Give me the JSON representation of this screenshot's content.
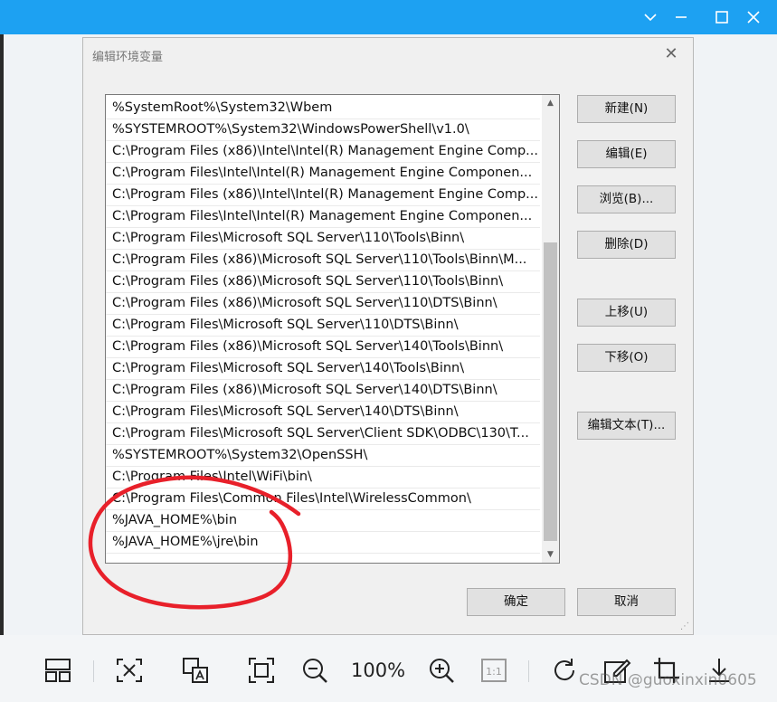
{
  "viewer": {
    "zoom_label": "100%",
    "watermark": "CSDN @guoxinxin0605"
  },
  "dialog": {
    "title": "编辑环境变量",
    "close_glyph": "✕",
    "entries": [
      "%SystemRoot%\\System32\\Wbem",
      "%SYSTEMROOT%\\System32\\WindowsPowerShell\\v1.0\\",
      "C:\\Program Files (x86)\\Intel\\Intel(R) Management Engine Comp...",
      "C:\\Program Files\\Intel\\Intel(R) Management Engine Componen...",
      "C:\\Program Files (x86)\\Intel\\Intel(R) Management Engine Comp...",
      "C:\\Program Files\\Intel\\Intel(R) Management Engine Componen...",
      "C:\\Program Files\\Microsoft SQL Server\\110\\Tools\\Binn\\",
      "C:\\Program Files (x86)\\Microsoft SQL Server\\110\\Tools\\Binn\\M...",
      "C:\\Program Files (x86)\\Microsoft SQL Server\\110\\Tools\\Binn\\",
      "C:\\Program Files (x86)\\Microsoft SQL Server\\110\\DTS\\Binn\\",
      "C:\\Program Files\\Microsoft SQL Server\\110\\DTS\\Binn\\",
      "C:\\Program Files (x86)\\Microsoft SQL Server\\140\\Tools\\Binn\\",
      "C:\\Program Files\\Microsoft SQL Server\\140\\Tools\\Binn\\",
      "C:\\Program Files (x86)\\Microsoft SQL Server\\140\\DTS\\Binn\\",
      "C:\\Program Files\\Microsoft SQL Server\\140\\DTS\\Binn\\",
      "C:\\Program Files\\Microsoft SQL Server\\Client SDK\\ODBC\\130\\T...",
      "%SYSTEMROOT%\\System32\\OpenSSH\\",
      "C:\\Program Files\\Intel\\WiFi\\bin\\",
      "C:\\Program Files\\Common Files\\Intel\\WirelessCommon\\",
      "%JAVA_HOME%\\bin",
      "%JAVA_HOME%\\jre\\bin",
      ""
    ],
    "buttons": {
      "new": "新建(N)",
      "edit": "编辑(E)",
      "browse": "浏览(B)...",
      "delete": "删除(D)",
      "move_up": "上移(U)",
      "move_down": "下移(O)",
      "edit_text": "编辑文本(T)...",
      "ok": "确定",
      "cancel": "取消"
    }
  },
  "colors": {
    "titlebar": "#1da1f2",
    "annotation": "#e8202a"
  }
}
